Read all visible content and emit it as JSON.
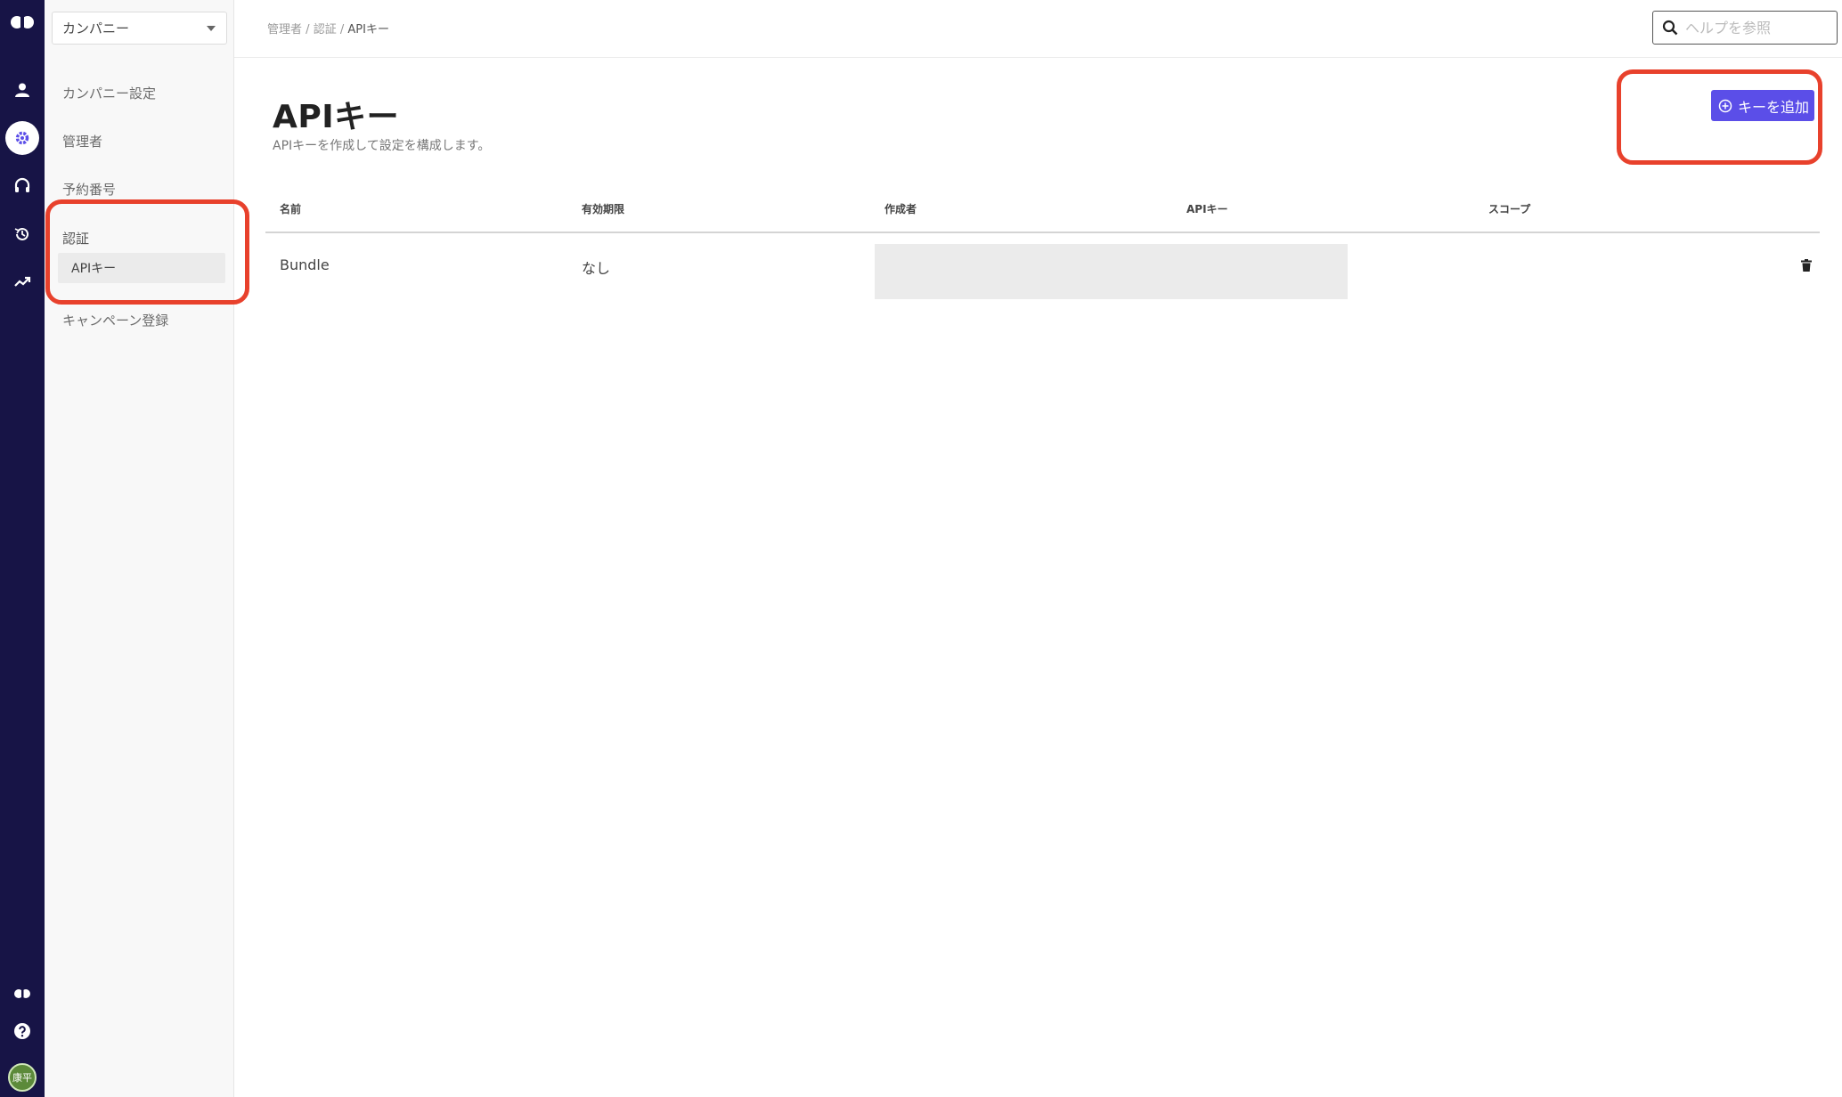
{
  "rail": {
    "icons": [
      "logo-icon",
      "user-icon",
      "gear-icon",
      "headset-icon",
      "history-icon",
      "trend-icon",
      "logo-small-icon",
      "help-icon"
    ],
    "avatar_text": "康平"
  },
  "sidebar": {
    "company_select": "カンパニー",
    "items": {
      "company_settings": "カンパニー設定",
      "admins": "管理者",
      "reserved_numbers": "予約番号",
      "auth": "認証",
      "api_keys": "APIキー",
      "campaign": "キャンペーン登録"
    }
  },
  "breadcrumb": {
    "level1": "管理者",
    "level2": "認証",
    "current": "APIキー",
    "separator": "/"
  },
  "search": {
    "placeholder": "ヘルプを参照"
  },
  "page": {
    "title": "APIキー",
    "subtitle": "APIキーを作成して設定を構成します。",
    "add_button": "キーを追加"
  },
  "table": {
    "headers": {
      "name": "名前",
      "expiry": "有効期限",
      "creator": "作成者",
      "api_key": "APIキー",
      "scope": "スコープ"
    },
    "rows": [
      {
        "name": "Bundle",
        "expiry": "なし"
      }
    ]
  },
  "colors": {
    "rail": "#171446",
    "accent": "#5b4ee8",
    "annotation": "#e8412c"
  }
}
